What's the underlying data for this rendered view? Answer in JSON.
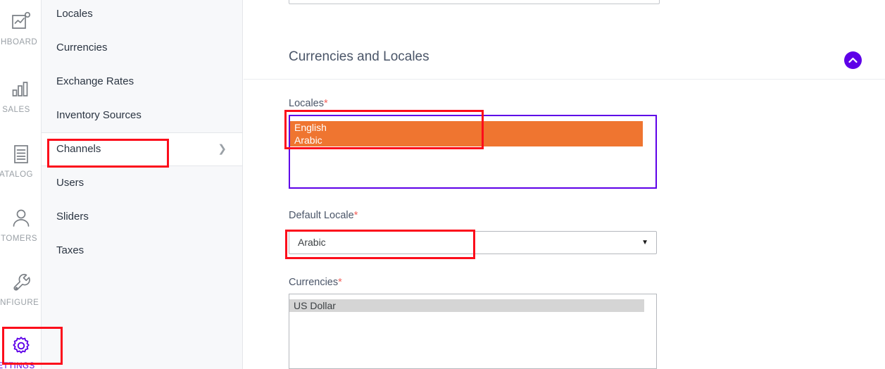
{
  "rail": {
    "items": [
      {
        "label": "SHBOARD",
        "icon": "dashboard-icon",
        "active": false
      },
      {
        "label": "SALES",
        "icon": "sales-bar-chart-icon",
        "active": false
      },
      {
        "label": "ATALOG",
        "icon": "catalog-document-icon",
        "active": false
      },
      {
        "label": "STOMERS",
        "icon": "customers-person-icon",
        "active": false
      },
      {
        "label": "ONFIGURE",
        "icon": "configure-wrench-icon",
        "active": false
      },
      {
        "label": "ETTINGS",
        "icon": "settings-gear-icon",
        "active": true
      }
    ]
  },
  "sub_nav": {
    "items": [
      {
        "label": "Locales",
        "selected": false,
        "has_chevron": false
      },
      {
        "label": "Currencies",
        "selected": false,
        "has_chevron": false
      },
      {
        "label": "Exchange Rates",
        "selected": false,
        "has_chevron": false
      },
      {
        "label": "Inventory Sources",
        "selected": false,
        "has_chevron": false
      },
      {
        "label": "Channels",
        "selected": true,
        "has_chevron": true
      },
      {
        "label": "Users",
        "selected": false,
        "has_chevron": false
      },
      {
        "label": "Sliders",
        "selected": false,
        "has_chevron": false
      },
      {
        "label": "Taxes",
        "selected": false,
        "has_chevron": false
      }
    ],
    "chevron_glyph": "❯"
  },
  "main": {
    "section_title": "Currencies and Locales",
    "collapse_icon": "chevron-up-icon",
    "fields": {
      "locales": {
        "label": "Locales",
        "required_mark": "*",
        "options": [
          {
            "text": "English",
            "state": "selected-focused"
          },
          {
            "text": "Arabic",
            "state": "selected-focused"
          }
        ]
      },
      "default_locale": {
        "label": "Default Locale",
        "required_mark": "*",
        "value": "Arabic",
        "caret_glyph": "▼"
      },
      "currencies": {
        "label": "Currencies",
        "required_mark": "*",
        "options": [
          {
            "text": "US Dollar",
            "state": "selected-unfocused"
          }
        ]
      }
    }
  },
  "colors": {
    "accent_violet": "#5E00E8",
    "selection_orange": "#EF7530",
    "selection_gray": "#D5D5D5",
    "required_red": "#F4605A",
    "annotation_red": "#FC0D1B",
    "sidebar_bg": "#F7F8FA"
  },
  "annotations": [
    {
      "name": "channels-highlight"
    },
    {
      "name": "locales-highlight"
    },
    {
      "name": "default-locale-highlight"
    },
    {
      "name": "settings-highlight"
    }
  ]
}
